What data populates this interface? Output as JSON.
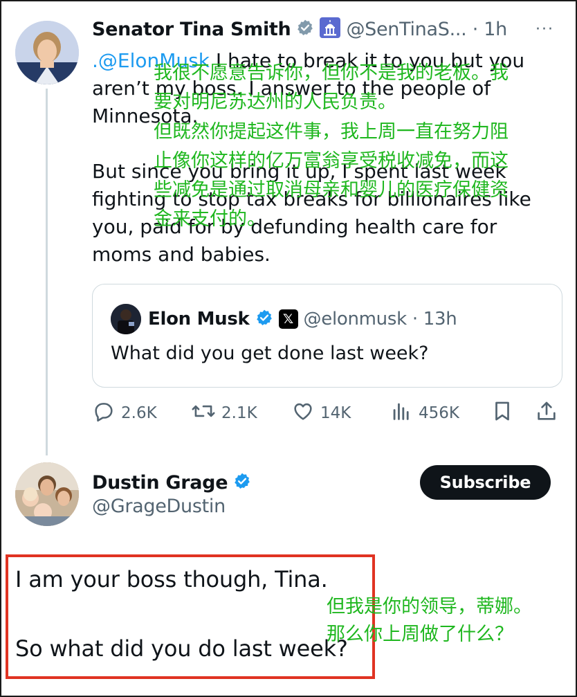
{
  "tweet1": {
    "author_name": "Senator Tina Smith",
    "handle_time": "@SenTinaS... · 1h",
    "more": "···",
    "mention": ".@ElonMusk",
    "line1_rest": " I hate to break it to you but you",
    "line2": "aren’t my boss. I answer to the people of",
    "line3": "Minnesota.",
    "line4": "But since you bring it up, I spent last week",
    "line5": "fighting to stop tax breaks for billionaires like",
    "line6": "you, paid for by defunding health care for",
    "line7": "moms and babies.",
    "quote": {
      "author_name": "Elon Musk",
      "x_badge": "𝕏",
      "handle_time": "@elonmusk · 13h",
      "text": "What did you get done last week?"
    },
    "stats": {
      "replies": "2.6K",
      "reposts": "2.1K",
      "likes": "14K",
      "views": "456K"
    }
  },
  "tweet2": {
    "author_name": "Dustin Grage",
    "handle": "@GrageDustin",
    "subscribe_label": "Subscribe",
    "reply_line1": "I am your boss though, Tina.",
    "reply_line2": "So what did you do last week?"
  },
  "annotations": {
    "a1": "我很不愿意告诉你，但你不是我的老板。我",
    "a2": "要对明尼苏达州的人民负责。",
    "a3": "但既然你提起这件事，我上周一直在努力阻",
    "a4": "止像你这样的亿万富翁享受税收减免，而这",
    "a5": "些减免是通过取消母亲和婴儿的医疗保健资",
    "a6": "金来支付的。",
    "b1": "但我是你的领导，蒂娜。",
    "b2": "那么你上周做了什么？"
  },
  "colors": {
    "text": "#0f1419",
    "secondary": "#536471",
    "link": "#1d9bf0",
    "verified": "#1d9bf0",
    "annotation": "#1fb71f",
    "highlight_box": "#e03322"
  }
}
